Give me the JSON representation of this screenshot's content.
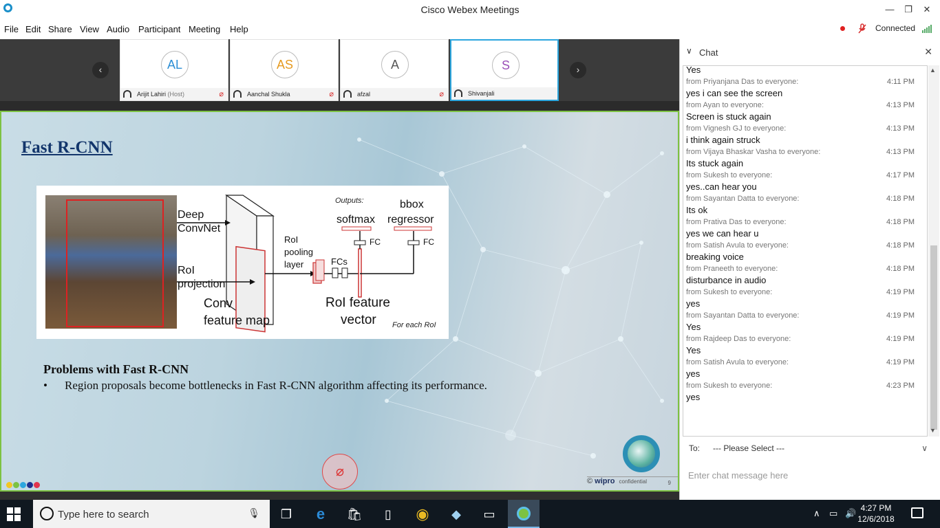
{
  "window": {
    "title": "Cisco Webex Meetings",
    "minimize": "—",
    "restore": "❐",
    "close": "✕"
  },
  "menu": [
    "File",
    "Edit",
    "Share",
    "View",
    "Audio",
    "Participant",
    "Meeting",
    "Help"
  ],
  "status": {
    "connected": "Connected"
  },
  "participants": [
    {
      "initials": "AL",
      "name": "Arijit Lahiri",
      "role": "(Host)",
      "color": "#2d8fd5"
    },
    {
      "initials": "AS",
      "name": "Aanchal Shukla",
      "role": "",
      "color": "#e69a20"
    },
    {
      "initials": "A",
      "name": "afzal",
      "role": "",
      "color": "#555555"
    },
    {
      "initials": "S",
      "name": "Shivanjali",
      "role": "",
      "color": "#9b4fb8"
    }
  ],
  "slide": {
    "title": "Fast R-CNN",
    "figure": {
      "deep": "Deep",
      "convnet": "ConvNet",
      "roi": "RoI",
      "projection": "projection",
      "conv": "Conv",
      "feature_map": "feature map",
      "roi_pooling_1": "RoI",
      "roi_pooling_2": "pooling",
      "roi_pooling_3": "layer",
      "fcs": "FCs",
      "roi_feature": "RoI feature",
      "vector": "vector",
      "outputs": "Outputs:",
      "softmax": "softmax",
      "bbox": "bbox",
      "regressor": "regressor",
      "fc1": "FC",
      "fc2": "FC",
      "for_each": "For each RoI"
    },
    "problems_title": "Problems with Fast R-CNN",
    "bullet_symbol": "•",
    "bullet": "Region proposals become bottlenecks in Fast R-CNN algorithm affecting its performance.",
    "footer_brand": "wipro",
    "footer_conf": "confidential",
    "footer_page": "9",
    "footer_copy": "©"
  },
  "chat": {
    "title": "Chat",
    "messages": [
      {
        "from": "",
        "time": "",
        "text": "Yes"
      },
      {
        "from": "from Priyanjana Das to everyone:",
        "time": "4:11 PM",
        "text": "yes i can see the screen"
      },
      {
        "from": "from Ayan to everyone:",
        "time": "4:13 PM",
        "text": "Screen is stuck again"
      },
      {
        "from": "from Vignesh GJ to everyone:",
        "time": "4:13 PM",
        "text": "i think again struck"
      },
      {
        "from": "from Vijaya Bhaskar Vasha to everyone:",
        "time": "4:13 PM",
        "text": "Its stuck again"
      },
      {
        "from": "from Sukesh to everyone:",
        "time": "4:17 PM",
        "text": "yes..can hear you"
      },
      {
        "from": "from Sayantan Datta to everyone:",
        "time": "4:18 PM",
        "text": "Its ok"
      },
      {
        "from": "from Prativa Das to everyone:",
        "time": "4:18 PM",
        "text": "yes we can hear u"
      },
      {
        "from": "from Satish Avula to everyone:",
        "time": "4:18 PM",
        "text": "breaking voice"
      },
      {
        "from": "from Praneeth to everyone:",
        "time": "4:18 PM",
        "text": "disturbance in audio"
      },
      {
        "from": "from Sukesh to everyone:",
        "time": "4:19 PM",
        "text": "yes"
      },
      {
        "from": "from Sayantan Datta to everyone:",
        "time": "4:19 PM",
        "text": "Yes"
      },
      {
        "from": "from Rajdeep Das to everyone:",
        "time": "4:19 PM",
        "text": "Yes"
      },
      {
        "from": "from Satish Avula to everyone:",
        "time": "4:19 PM",
        "text": "yes"
      },
      {
        "from": "from Sukesh to everyone:",
        "time": "4:23 PM",
        "text": "yes"
      }
    ],
    "to_label": "To:",
    "to_value": "--- Please Select ---",
    "input_placeholder": "Enter chat message here"
  },
  "taskbar": {
    "search_placeholder": "Type here to search",
    "time": "4:27 PM",
    "date": "12/6/2018"
  },
  "colors": {
    "accent": "#2ba6de",
    "share_border": "#7dc242",
    "slide_title": "#12356b",
    "muted": "#d83030"
  }
}
